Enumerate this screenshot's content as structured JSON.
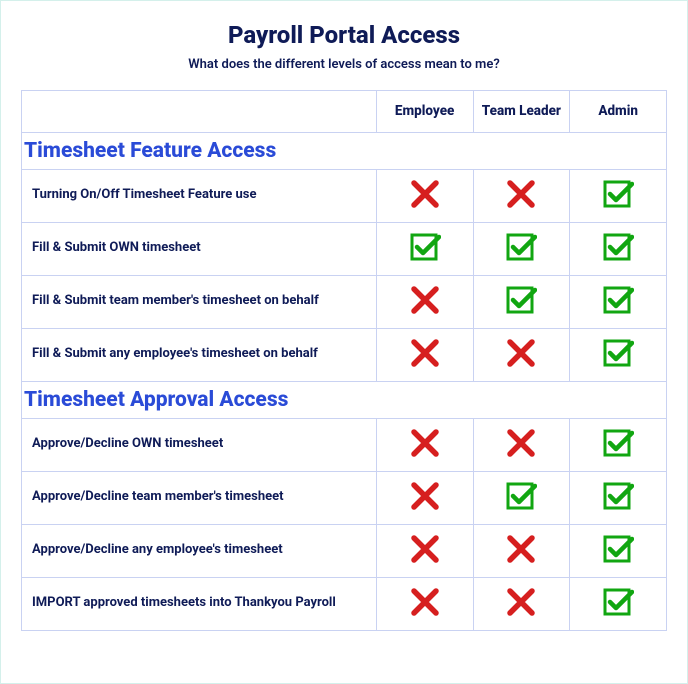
{
  "page": {
    "title": "Payroll Portal Access",
    "subtitle": "What does the different levels of access mean to me?"
  },
  "columns": [
    {
      "key": "employee",
      "label": "Employee"
    },
    {
      "key": "team_leader",
      "label": "Team Leader"
    },
    {
      "key": "admin",
      "label": "Admin"
    }
  ],
  "sections": [
    {
      "heading": "Timesheet Feature Access",
      "rows": [
        {
          "label": "Turning On/Off Timesheet Feature use",
          "employee": false,
          "team_leader": false,
          "admin": true
        },
        {
          "label": "Fill & Submit OWN timesheet",
          "employee": true,
          "team_leader": true,
          "admin": true
        },
        {
          "label": "Fill & Submit team member's timesheet on behalf",
          "employee": false,
          "team_leader": true,
          "admin": true
        },
        {
          "label": "Fill & Submit any employee's timesheet on behalf",
          "employee": false,
          "team_leader": false,
          "admin": true
        }
      ]
    },
    {
      "heading": "Timesheet Approval Access",
      "rows": [
        {
          "label": "Approve/Decline OWN timesheet",
          "employee": false,
          "team_leader": false,
          "admin": true
        },
        {
          "label": "Approve/Decline team member's timesheet",
          "employee": false,
          "team_leader": true,
          "admin": true
        },
        {
          "label": "Approve/Decline any employee's timesheet",
          "employee": false,
          "team_leader": false,
          "admin": true
        },
        {
          "label": "IMPORT approved timesheets into Thankyou Payroll",
          "employee": false,
          "team_leader": false,
          "admin": true
        }
      ]
    }
  ],
  "icons": {
    "yes": "check-icon",
    "no": "x-icon"
  }
}
